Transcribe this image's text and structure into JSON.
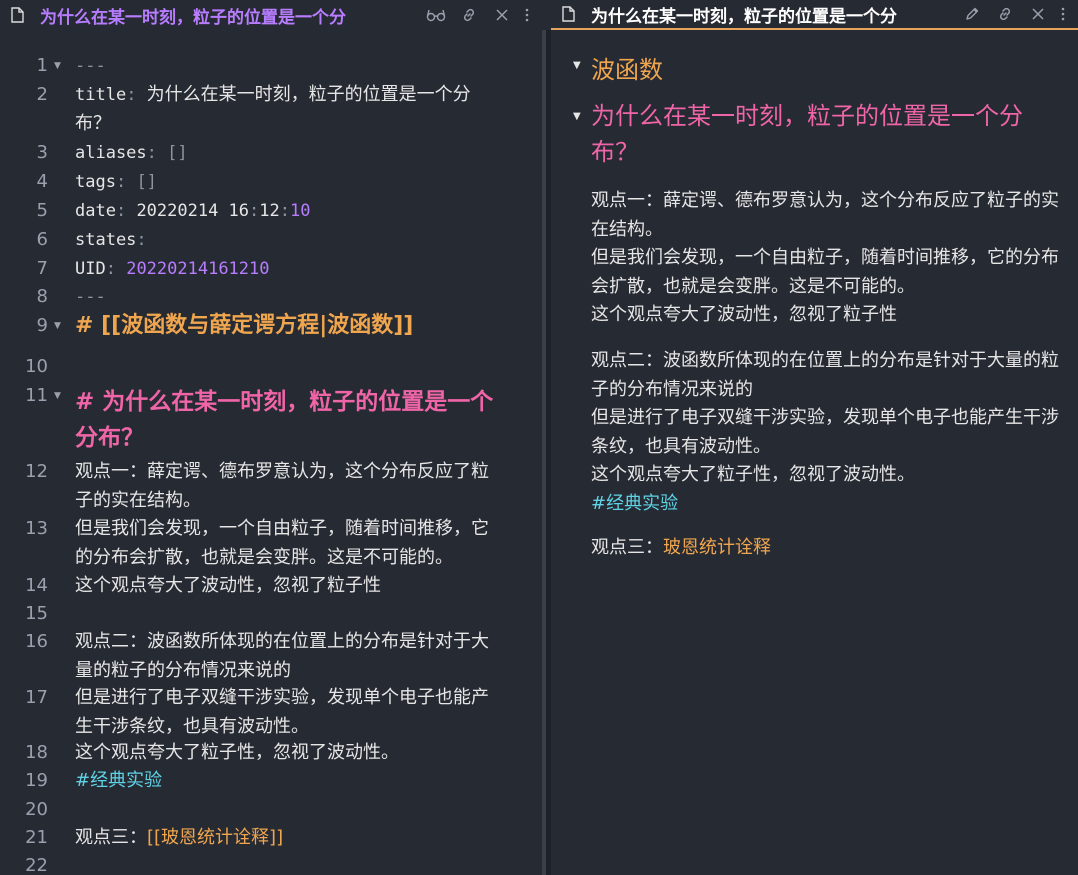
{
  "left_tab": {
    "title": "为什么在某一时刻，粒子的位置是一个分",
    "icons": [
      "file-icon",
      "reading-glasses-icon",
      "link-icon",
      "close-icon",
      "more-options-icon"
    ]
  },
  "right_tab": {
    "title": "为什么在某一时刻，粒子的位置是一个分",
    "icons": [
      "file-icon",
      "edit-pencil-icon",
      "link-icon",
      "close-icon",
      "more-options-icon"
    ]
  },
  "editor": {
    "line_numbers": [
      "1",
      "2",
      "3",
      "4",
      "5",
      "6",
      "7",
      "8",
      "9",
      "10",
      "11",
      "12",
      "13",
      "14",
      "15",
      "16",
      "17",
      "18",
      "19",
      "20",
      "21",
      "22"
    ],
    "frontmatter_delim": "---",
    "title_key": "title",
    "title_value": "为什么在某一时刻，粒子的位置是一个分布？",
    "aliases_key": "aliases",
    "aliases_value": "[]",
    "tags_key": "tags",
    "tags_value": "[]",
    "date_key": "date",
    "date_value_a": "20220214 16",
    "date_value_b": "12",
    "date_value_c": "10",
    "states_key": "states",
    "uid_key": "UID",
    "uid_value": "20220214161210",
    "heading1": "# [[波函数与薛定谔方程|波函数]]",
    "heading2": "# 为什么在某一时刻，粒子的位置是一个分布？",
    "line12": "观点一：薛定谔、德布罗意认为，这个分布反应了粒子的实在结构。",
    "line13": "但是我们会发现，一个自由粒子，随着时间推移，它的分布会扩散，也就是会变胖。这是不可能的。",
    "line14": "这个观点夸大了波动性，忽视了粒子性",
    "line16": "观点二：波函数所体现的在位置上的分布是针对于大量的粒子的分布情况来说的",
    "line17": "但是进行了电子双缝干涉实验，发现单个电子也能产生干涉条纹，也具有波动性。",
    "line18": "这个观点夸大了粒子性，忽视了波动性。",
    "line19": "#经典实验",
    "line21_prefix": "观点三：",
    "line21_link": "[[玻恩统计诠释]]"
  },
  "preview": {
    "heading1": "波函数",
    "heading2": "为什么在某一时刻，粒子的位置是一个分布？",
    "p1_line1": "观点一：薛定谔、德布罗意认为，这个分布反应了粒子的实在结构。",
    "p1_line2": "但是我们会发现，一个自由粒子，随着时间推移，它的分布会扩散，也就是会变胖。这是不可能的。",
    "p1_line3": "这个观点夸大了波动性，忽视了粒子性",
    "p2_line1": "观点二：波函数所体现的在位置上的分布是针对于大量的粒子的分布情况来说的",
    "p2_line2": "但是进行了电子双缝干涉实验，发现单个电子也能产生干涉条纹，也具有波动性。",
    "p2_line3": "这个观点夸大了粒子性，忽视了波动性。",
    "p2_tag": "#经典实验",
    "p3_prefix": "观点三：",
    "p3_link": "玻恩统计诠释"
  },
  "colors": {
    "background": "#262a33",
    "accent_orange": "#f0a64e",
    "heading_pink": "#f065a8",
    "accent_purple": "#b87dff",
    "tag_cyan": "#5fd3e6"
  }
}
